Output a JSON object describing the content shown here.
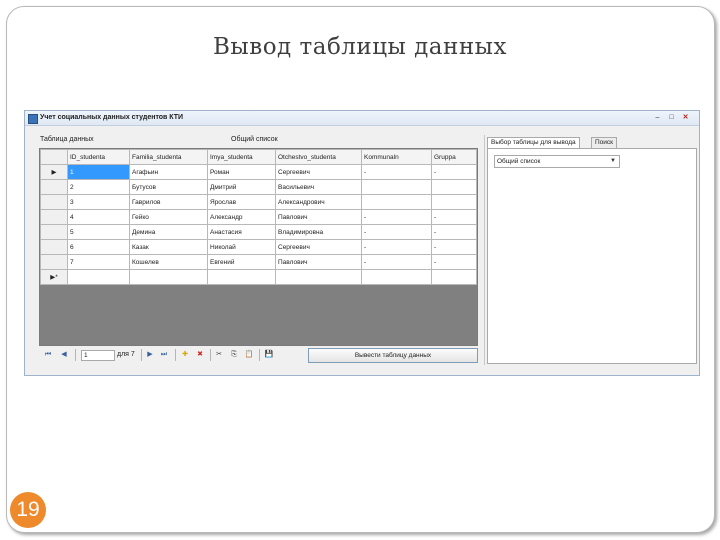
{
  "slide": {
    "title": "Вывод таблицы данных",
    "page_number": "19"
  },
  "window": {
    "title": "Учет социальных данных студентов КТИ",
    "buttons": {
      "minimize": "–",
      "maximize": "□",
      "close": "✕"
    }
  },
  "labels": {
    "table_label": "Таблица данных",
    "list_label": "Общий список"
  },
  "grid": {
    "columns": [
      "ID_studenta",
      "Familia_studenta",
      "Imya_studenta",
      "Otchestvo_studenta",
      "Kommunaln",
      "Gruppa"
    ],
    "rows": [
      {
        "marker": "▶",
        "cells": [
          "1",
          "Агафьин",
          "Роман",
          "Сергеевич",
          "-",
          "-"
        ]
      },
      {
        "marker": "",
        "cells": [
          "2",
          "Бутусов",
          "Дмитрий",
          "Васильевич",
          "",
          ""
        ]
      },
      {
        "marker": "",
        "cells": [
          "3",
          "Гаврилов",
          "Ярослав",
          "Александрович",
          "",
          ""
        ]
      },
      {
        "marker": "",
        "cells": [
          "4",
          "Гейко",
          "Александр",
          "Павлович",
          "-",
          "-"
        ]
      },
      {
        "marker": "",
        "cells": [
          "5",
          "Демина",
          "Анастасия",
          "Владимировна",
          "-",
          "-"
        ]
      },
      {
        "marker": "",
        "cells": [
          "6",
          "Казак",
          "Николай",
          "Сергеевич",
          "-",
          "-"
        ]
      },
      {
        "marker": "",
        "cells": [
          "7",
          "Кошелев",
          "Евгений",
          "Павлович",
          "-",
          "-"
        ]
      },
      {
        "marker": "▶*",
        "cells": [
          "",
          "",
          "",
          "",
          "",
          ""
        ]
      }
    ]
  },
  "navigator": {
    "first": "⏮",
    "prev": "◀",
    "position": "1",
    "count": "для 7",
    "next": "▶",
    "last": "⏭",
    "add": "✚",
    "delete": "✖",
    "cut": "✂",
    "copy": "⎘",
    "paste": "📋",
    "save": "💾"
  },
  "show_button_label": "Вывести таблицу данных",
  "right_panel": {
    "tabs": [
      "Выбор таблицы для вывода",
      "Поиск"
    ],
    "combo_value": "Общий список",
    "combo_arrow": "▼"
  }
}
